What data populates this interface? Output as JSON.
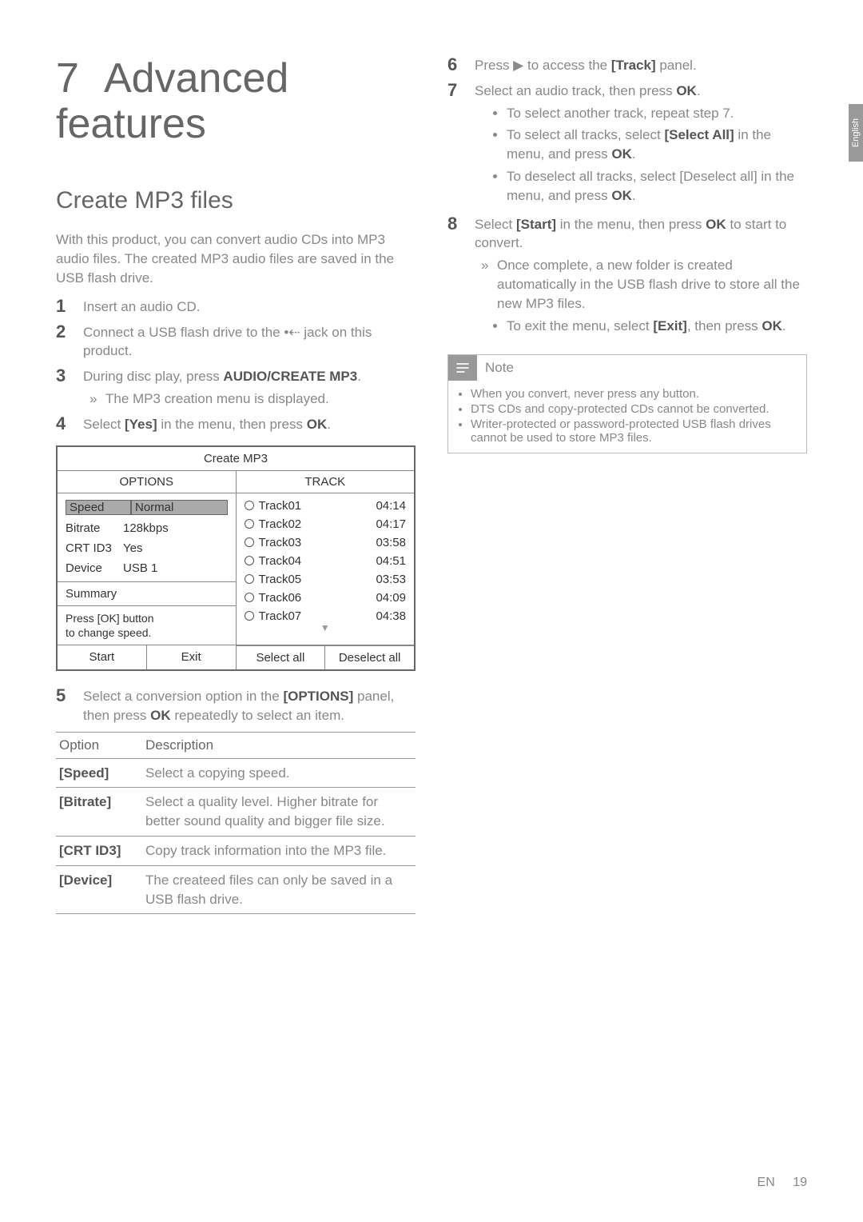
{
  "chapter": {
    "number": "7",
    "title": "Advanced features"
  },
  "section": {
    "title": "Create MP3 files"
  },
  "intro": "With this product, you can convert audio CDs into MP3 audio files. The created MP3 audio files are saved in the USB flash drive.",
  "left_steps": {
    "s1": "Insert an audio CD.",
    "s2a": "Connect a USB flash drive to the ",
    "s2b": " jack on this product.",
    "s3a": "During disc play, press ",
    "s3b": "AUDIO/CREATE MP3",
    "s3c": ".",
    "s3_result": "The MP3 creation menu is displayed.",
    "s4a": "Select ",
    "s4b": "[Yes]",
    "s4c": " in the menu, then press ",
    "s4d": "OK",
    "s4e": ".",
    "s5a": "Select a conversion option in the ",
    "s5b": "[OPTIONS]",
    "s5c": " panel, then press ",
    "s5d": "OK",
    "s5e": " repeatedly to select an item."
  },
  "mp3_panel": {
    "title": "Create MP3",
    "options_header": "OPTIONS",
    "track_header": "TRACK",
    "opts": [
      {
        "key": "Speed",
        "val": "Normal",
        "sel": true
      },
      {
        "key": "Bitrate",
        "val": "128kbps"
      },
      {
        "key": "CRT ID3",
        "val": "Yes"
      },
      {
        "key": "Device",
        "val": "USB 1"
      }
    ],
    "summary": "Summary",
    "hint1": "Press [OK] button",
    "hint2": "to change speed.",
    "tracks": [
      {
        "name": "Track01",
        "dur": "04:14"
      },
      {
        "name": "Track02",
        "dur": "04:17"
      },
      {
        "name": "Track03",
        "dur": "03:58"
      },
      {
        "name": "Track04",
        "dur": "04:51"
      },
      {
        "name": "Track05",
        "dur": "03:53"
      },
      {
        "name": "Track06",
        "dur": "04:09"
      },
      {
        "name": "Track07",
        "dur": "04:38"
      }
    ],
    "footer": {
      "start": "Start",
      "exit": "Exit",
      "select_all": "Select all",
      "deselect_all": "Deselect all"
    }
  },
  "options_table": {
    "head_option": "Option",
    "head_desc": "Description",
    "rows": [
      {
        "label": "[Speed]",
        "desc": "Select a copying speed."
      },
      {
        "label": "[Bitrate]",
        "desc": "Select a quality level. Higher bitrate for better sound quality and bigger file size."
      },
      {
        "label": "[CRT ID3]",
        "desc": "Copy track information into the MP3 file."
      },
      {
        "label": "[Device]",
        "desc": "The createed files can only be saved in a USB flash drive."
      }
    ]
  },
  "right_steps": {
    "s6a": "Press ▶ to access the ",
    "s6b": "[Track]",
    "s6c": " panel.",
    "s7a": "Select an audio track, then press ",
    "s7b": "OK",
    "s7c": ".",
    "s7_sub1": "To select another track, repeat step 7.",
    "s7_sub2a": "To select all tracks, select ",
    "s7_sub2b": "[Select All]",
    "s7_sub2c": " in the menu, and press ",
    "s7_sub2d": "OK",
    "s7_sub2e": ".",
    "s7_sub3a": "To deselect all tracks, select [Deselect all] in the menu, and press ",
    "s7_sub3b": "OK",
    "s7_sub3c": ".",
    "s8a": "Select ",
    "s8b": "[Start]",
    "s8c": " in the menu, then press ",
    "s8d": "OK",
    "s8e": " to start to convert.",
    "s8_result": "Once complete, a new folder is created automatically in the USB flash drive to store all the new MP3 files.",
    "s8_sub1a": "To exit the menu, select ",
    "s8_sub1b": "[Exit]",
    "s8_sub1c": ", then press ",
    "s8_sub1d": "OK",
    "s8_sub1e": "."
  },
  "note": {
    "title": "Note",
    "items": [
      "When you convert, never press any button.",
      "DTS CDs and copy-protected CDs cannot be converted.",
      "Writer-protected or password-protected USB flash drives cannot be used to store MP3 files."
    ]
  },
  "side_tab": "English",
  "footer": {
    "lang": "EN",
    "page": "19"
  }
}
